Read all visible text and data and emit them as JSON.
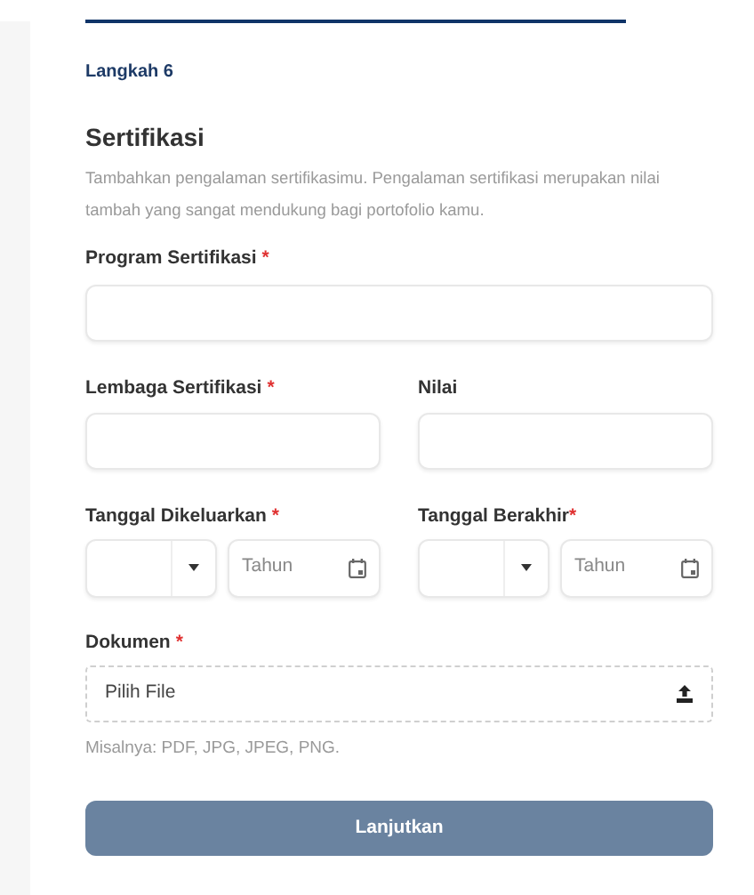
{
  "step": "Langkah 6",
  "title": "Sertifikasi",
  "description": "Tambahkan pengalaman sertifikasimu. Pengalaman sertifikasi merupakan nilai tambah yang sangat mendukung bagi portofolio kamu.",
  "program": {
    "label": "Program Sertifikasi",
    "required_mark": "*"
  },
  "row_fields": [
    {
      "label": "Lembaga Sertifikasi",
      "required_mark": "*"
    },
    {
      "label": "Nilai"
    }
  ],
  "dates": [
    {
      "label": "Tanggal Dikeluarkan",
      "required_mark": "*",
      "year_placeholder": "Tahun"
    },
    {
      "label": "Tanggal Berakhir",
      "required_mark": "*",
      "year_placeholder": "Tahun"
    }
  ],
  "document": {
    "label": "Dokumen",
    "required_mark": "*",
    "button": "Pilih File",
    "hint": "Misalnya: PDF, JPG, JPEG, PNG."
  },
  "submit": "Lanjutkan"
}
